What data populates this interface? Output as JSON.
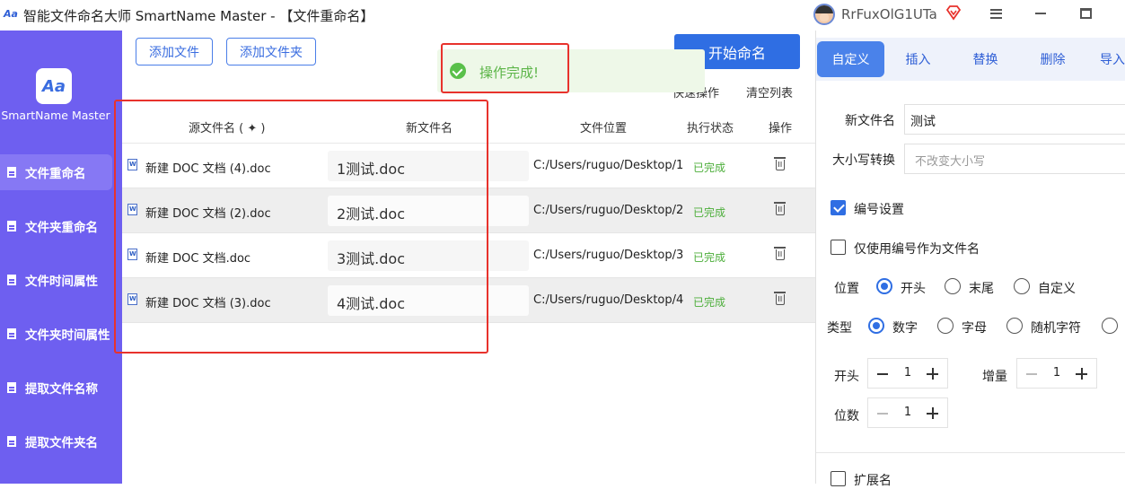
{
  "window": {
    "title": "智能文件命名大师 SmartName Master - 【文件重命名】",
    "user_name": "RrFuxOlG1UTa"
  },
  "sidebar": {
    "brand_name": "SmartName Master",
    "items": [
      {
        "label": "文件重命名",
        "active": true
      },
      {
        "label": "文件夹重命名"
      },
      {
        "label": "文件时间属性"
      },
      {
        "label": "文件夹时间属性"
      },
      {
        "label": "提取文件名称"
      },
      {
        "label": "提取文件夹名"
      }
    ]
  },
  "toolbar": {
    "add_file": "添加文件",
    "add_folder": "添加文件夹",
    "start": "开始命名",
    "quick_ops": "快速操作",
    "clear_list": "清空列表"
  },
  "toast": {
    "message": "操作完成!",
    "color": "#5cb548"
  },
  "table": {
    "headers": {
      "source": "源文件名 ( ✦ )",
      "new_name": "新文件名",
      "location": "文件位置",
      "status": "执行状态",
      "action": "操作"
    },
    "rows": [
      {
        "source": "新建 DOC 文档 (4).doc",
        "new_name": "1测试.doc",
        "location": "C:/Users/ruguo/Desktop/1",
        "status": "已完成"
      },
      {
        "source": "新建 DOC 文档 (2).doc",
        "new_name": "2测试.doc",
        "location": "C:/Users/ruguo/Desktop/2",
        "status": "已完成"
      },
      {
        "source": "新建 DOC 文档.doc",
        "new_name": "3测试.doc",
        "location": "C:/Users/ruguo/Desktop/3",
        "status": "已完成"
      },
      {
        "source": "新建 DOC 文档 (3).doc",
        "new_name": "4测试.doc",
        "location": "C:/Users/ruguo/Desktop/4",
        "status": "已完成"
      }
    ]
  },
  "panel": {
    "tabs": [
      "自定义",
      "插入",
      "替换",
      "删除",
      "导入"
    ],
    "new_name_label": "新文件名",
    "new_name_value": "测试",
    "case_label": "大小写转换",
    "case_placeholder": "不改变大小写",
    "numbering_label": "编号设置",
    "numbering_checked": true,
    "only_number_label": "仅使用编号作为文件名",
    "only_number_checked": false,
    "position_label": "位置",
    "position_options": [
      "开头",
      "末尾",
      "自定义"
    ],
    "position_selected": "开头",
    "type_label": "类型",
    "type_options": [
      "数字",
      "字母",
      "随机字符"
    ],
    "type_selected": "数字",
    "start_label": "开头",
    "start_value": "1",
    "step_label": "增量",
    "step_value": "1",
    "digits_label": "位数",
    "digits_value": "1",
    "extension_label": "扩展名"
  },
  "colors": {
    "sidebar": "#6e5ff0",
    "accent": "#2f6ee3",
    "highlight": "#e8322c"
  }
}
